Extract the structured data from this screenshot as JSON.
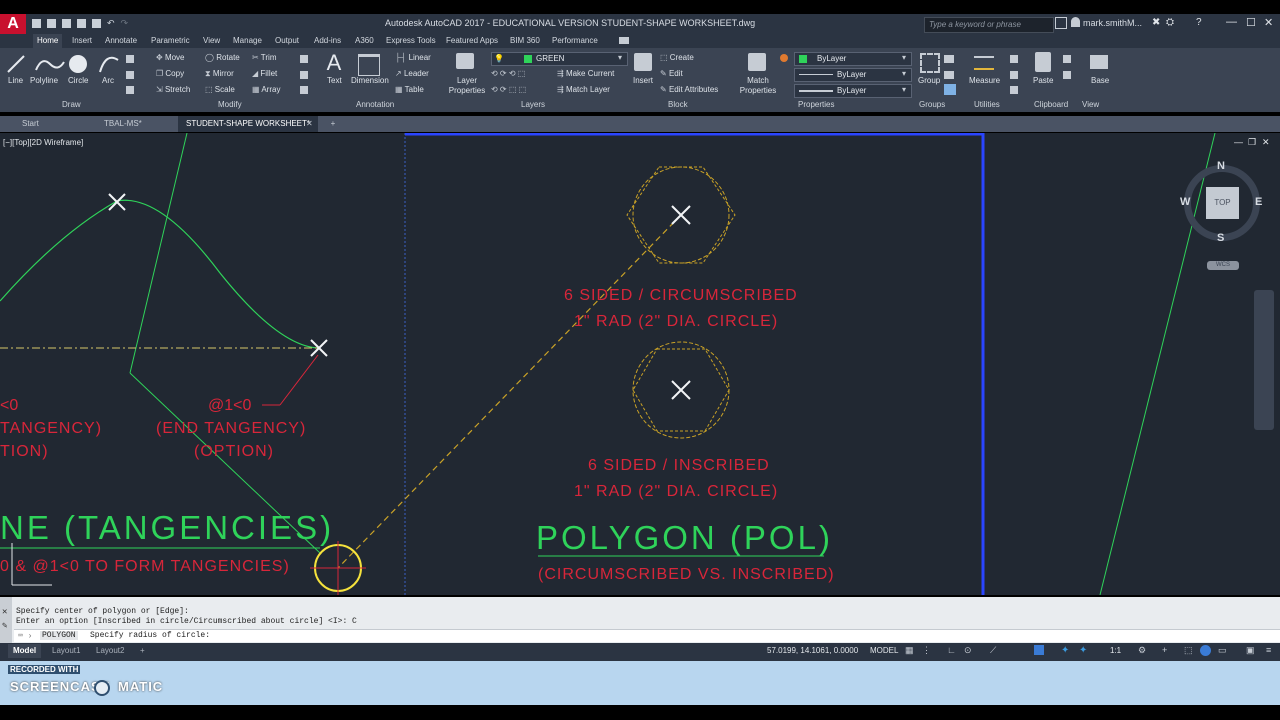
{
  "app": {
    "logo": "A",
    "title": "Autodesk AutoCAD 2017 - EDUCATIONAL VERSION   STUDENT-SHAPE WORKSHEET.dwg",
    "search_placeholder": "Type a keyword or phrase",
    "user": "mark.smithM..."
  },
  "ribbon": {
    "tabs": [
      "Home",
      "Insert",
      "Annotate",
      "Parametric",
      "View",
      "Manage",
      "Output",
      "Add-ins",
      "A360",
      "Express Tools",
      "Featured Apps",
      "BIM 360",
      "Performance"
    ],
    "active_tab": "Home",
    "draw": {
      "label": "Draw",
      "line": "Line",
      "polyline": "Polyline",
      "circle": "Circle",
      "arc": "Arc"
    },
    "modify": {
      "label": "Modify",
      "move": "Move",
      "rotate": "Rotate",
      "trim": "Trim",
      "copy": "Copy",
      "mirror": "Mirror",
      "fillet": "Fillet",
      "stretch": "Stretch",
      "scale": "Scale",
      "array": "Array"
    },
    "annotation": {
      "label": "Annotation",
      "text": "Text",
      "dimension": "Dimension",
      "linear": "Linear",
      "leader": "Leader",
      "table": "Table"
    },
    "layers": {
      "label": "Layers",
      "layer_properties": "Layer Properties",
      "current_layer": "GREEN",
      "make_current": "Make Current",
      "match_layer": "Match Layer"
    },
    "block": {
      "label": "Block",
      "insert": "Insert",
      "create": "Create",
      "edit": "Edit",
      "edit_attributes": "Edit Attributes"
    },
    "properties": {
      "label": "Properties",
      "match_properties": "Match Properties",
      "color": "ByLayer",
      "linetype": "ByLayer",
      "lineweight": "ByLayer"
    },
    "groups": {
      "label": "Groups",
      "group": "Group"
    },
    "utilities": {
      "label": "Utilities",
      "measure": "Measure"
    },
    "clipboard": {
      "label": "Clipboard",
      "paste": "Paste"
    },
    "view": {
      "label": "View",
      "base": "Base"
    }
  },
  "doc_tabs": {
    "tabs": [
      "Start",
      "TBAL-MS*",
      "STUDENT-SHAPE WORKSHEET*"
    ],
    "active": "STUDENT-SHAPE WORKSHEET*",
    "add": "+"
  },
  "viewport": {
    "label": "[−][Top][2D Wireframe]",
    "viewcube": {
      "n": "N",
      "s": "S",
      "e": "E",
      "w": "W",
      "top": "TOP",
      "wcs": "WCS"
    }
  },
  "drawing": {
    "circ_line1": "6 SIDED / CIRCUMSCRIBED",
    "circ_line2": "1\" RAD (2\" DIA. CIRCLE)",
    "insc_line1": "6 SIDED / INSCRIBED",
    "insc_line2": "1\" RAD (2\" DIA. CIRCLE)",
    "polygon_title": "POLYGON (POL)",
    "polygon_sub": "(CIRCUMSCRIBED VS. INSCRIBED)",
    "left_a1": "<0",
    "left_a2": "TANGENCY)",
    "left_a3": "TION)",
    "left_b1": "@1<0",
    "left_b2": "(END TANGENCY)",
    "left_b3": "(OPTION)",
    "spline_title": "NE (TANGENCIES)",
    "spline_sub": "0 & @1<0 TO FORM TANGENCIES)",
    "colors": {
      "green": "#2fd35a",
      "red": "#d8263a",
      "yellow": "#c9a227",
      "canvas": "#212832"
    }
  },
  "command": {
    "line1": "Specify center of polygon or [Edge]:",
    "line2": "Enter an option [Inscribed in circle/Circumscribed about circle] <I>: C",
    "prompt_cmd": "POLYGON",
    "prompt_text": "Specify radius of circle:"
  },
  "status": {
    "tabs": [
      "Model",
      "Layout1",
      "Layout2"
    ],
    "active": "Model",
    "add": "+",
    "coords": "57.0199, 14.1061, 0.0000",
    "mode": "MODEL",
    "scale": "1:1"
  },
  "watermark": {
    "recorded": "RECORDED WITH",
    "brand": "SCREENCAST",
    "suffix": "MATIC"
  }
}
